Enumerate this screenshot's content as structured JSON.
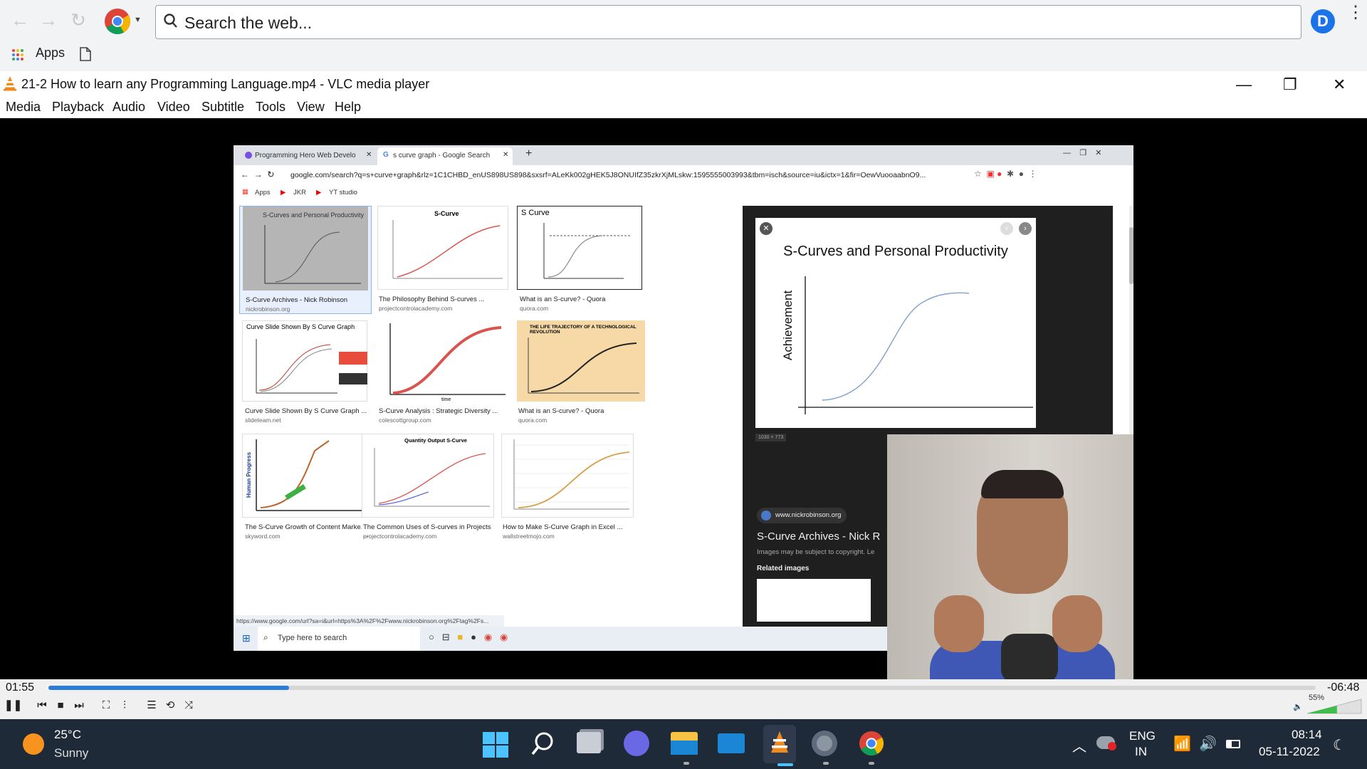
{
  "chrome": {
    "search_placeholder": "Search the web...",
    "profile_letter": "D",
    "bookmarks_apps": "Apps"
  },
  "vlc": {
    "title": "21-2 How to learn any Programming Language.mp4 - VLC media player",
    "menu": [
      "Media",
      "Playback",
      "Audio",
      "Video",
      "Subtitle",
      "Tools",
      "View",
      "Help"
    ],
    "time_elapsed": "01:55",
    "time_remaining": "-06:48",
    "progress": 0.19,
    "volume": "55%"
  },
  "video": {
    "tabs": [
      "Programming Hero Web Develo",
      "s curve graph - Google Search"
    ],
    "url": "google.com/search?q=s+curve+graph&rlz=1C1CHBD_enUS898US898&sxsrf=ALeKk002gHEK5J8ONUIfZ35zkrXjMLskw:1595555003993&tbm=isch&source=iu&ictx=1&fir=OewVuooaabnO9...",
    "bookmarks": [
      "Apps",
      "JKR",
      "YT studio"
    ],
    "results": [
      {
        "title": "S-Curves and Personal Productivity",
        "caption": "S-Curve Archives - Nick Robinson",
        "source": "nickrobinson.org"
      },
      {
        "title": "S-Curve",
        "caption": "The Philosophy Behind S-curves ...",
        "source": "projectcontrolacademy.com"
      },
      {
        "title": "S Curve",
        "caption": "What is an S-curve? - Quora",
        "source": "quora.com"
      },
      {
        "title": "Curve Slide Shown By S Curve Graph",
        "caption": "Curve Slide Shown By S Curve Graph ...",
        "source": "slideteam.net"
      },
      {
        "title": "",
        "caption": "S-Curve Analysis : Strategic Diversity ...",
        "source": "colescottgroup.com"
      },
      {
        "title": "THE LIFE TRAJECTORY OF A TECHNOLOGICAL REVOLUTION",
        "caption": "What is an S-curve? - Quora",
        "source": "quora.com"
      },
      {
        "title": "Human Progress",
        "caption": "The S-Curve Growth of Content Marke...",
        "source": "skyword.com"
      },
      {
        "title": "Quantity Output S-Curve",
        "caption": "The Common Uses of S-curves in Projects ...",
        "source": "projectcontrolacademy.com"
      },
      {
        "title": "",
        "caption": "How to Make S-Curve Graph in Excel ...",
        "source": "wallstreetmojo.com"
      }
    ],
    "preview": {
      "title": "S-Curves and Personal Productivity",
      "ylabel": "Achievement",
      "dims": "1030 × 773",
      "site": "www.nickrobinson.org",
      "heading": "S-Curve Archives - Nick R",
      "copyright": "Images may be subject to copyright. Le",
      "related": "Related images"
    },
    "status_url": "https://www.google.com/url?sa=i&url=https%3A%2F%2Fwww.nickrobinson.org%2Ftag%2Fs...",
    "taskbar_search": "Type here to search"
  },
  "windows": {
    "weather_temp": "25°C",
    "weather_desc": "Sunny",
    "lang": "ENG",
    "region": "IN",
    "time": "08:14",
    "date": "05-11-2022"
  },
  "colors": {
    "accent": "#2b7bd9",
    "taskbar": "#1f2a38",
    "vlc_orange": "#f08a1c"
  }
}
